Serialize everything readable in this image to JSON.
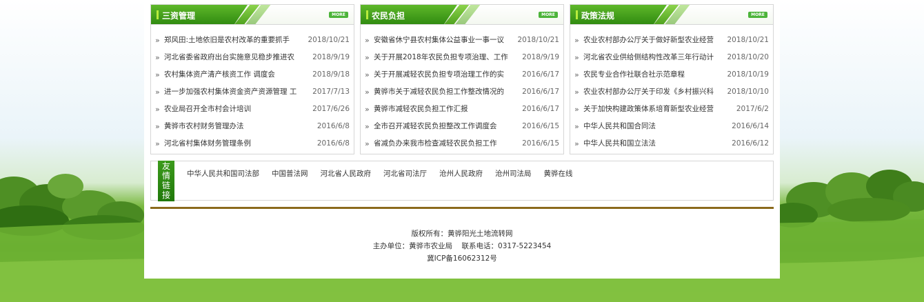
{
  "panels": [
    {
      "title": "三资管理",
      "more": "MORE",
      "items": [
        {
          "title": "郑风田:土地依旧是农村改革的重要抓手",
          "date": "2018/10/21"
        },
        {
          "title": "河北省委省政府出台实施意见稳步推进农",
          "date": "2018/9/19"
        },
        {
          "title": "农村集体资产清产核资工作 调度会",
          "date": "2018/9/18"
        },
        {
          "title": "进一步加强农村集体资金资产资源管理 工",
          "date": "2017/7/13"
        },
        {
          "title": "农业局召开全市村会计培训",
          "date": "2017/6/26"
        },
        {
          "title": "黄骅市农村财务管理办法",
          "date": "2016/6/8"
        },
        {
          "title": "河北省村集体财务管理条例",
          "date": "2016/6/8"
        }
      ]
    },
    {
      "title": "农民负担",
      "more": "MORE",
      "items": [
        {
          "title": "安徽省休宁县农村集体公益事业一事一议",
          "date": "2018/10/21"
        },
        {
          "title": "关于开展2018年农民负担专项治理、工作",
          "date": "2018/9/19"
        },
        {
          "title": "关于开展减轻农民负担专项治理工作的实",
          "date": "2016/6/17"
        },
        {
          "title": "黄骅市关于减轻农民负担工作整改情况的",
          "date": "2016/6/17"
        },
        {
          "title": "黄骅市减轻农民负担工作汇报",
          "date": "2016/6/17"
        },
        {
          "title": "全市召开减轻农民负担整改工作调度会",
          "date": "2016/6/15"
        },
        {
          "title": "省减负办来我市检查减轻农民负担工作",
          "date": "2016/6/15"
        }
      ]
    },
    {
      "title": "政策法规",
      "more": "MORE",
      "items": [
        {
          "title": "农业农村部办公厅关于做好新型农业经营",
          "date": "2018/10/21"
        },
        {
          "title": "河北省农业供给侧结构性改革三年行动计",
          "date": "2018/10/20"
        },
        {
          "title": "农民专业合作社联合社示范章程",
          "date": "2018/10/19"
        },
        {
          "title": "农业农村部办公厅关于印发《乡村振兴科",
          "date": "2018/10/10"
        },
        {
          "title": "关于加快构建政策体系培育新型农业经营",
          "date": "2017/6/2"
        },
        {
          "title": "中华人民共和国合同法",
          "date": "2016/6/14"
        },
        {
          "title": "中华人民共和国立法法",
          "date": "2016/6/12"
        }
      ]
    }
  ],
  "links": {
    "label": [
      "友",
      "情",
      "链",
      "接"
    ],
    "items": [
      "中华人民共和国司法部",
      "中国普法网",
      "河北省人民政府",
      "河北省司法厅",
      "沧州人民政府",
      "沧州司法局",
      "黄骅在线"
    ]
  },
  "footer": {
    "copyright": "版权所有：黄骅阳光土地流转网",
    "sponsor": "主办单位：黄骅市农业局    联系电话：0317-5223454",
    "icp": "冀ICP备16062312号"
  },
  "colors": {
    "accent_green": "#3c9b1c",
    "divider_brown": "#8b6a1c",
    "more_green": "#4cb43a"
  }
}
